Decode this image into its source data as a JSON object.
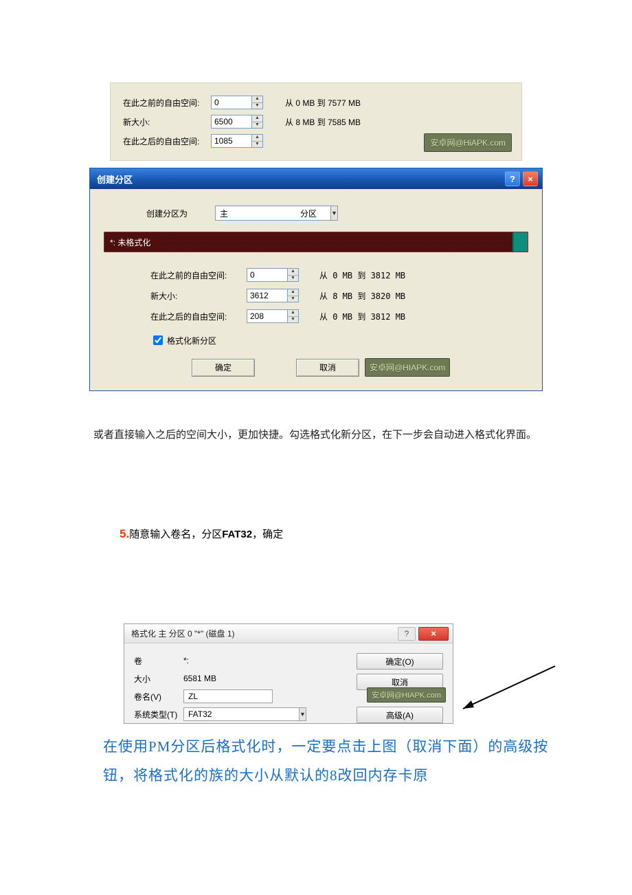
{
  "panel1": {
    "rows": [
      {
        "label": "在此之前的自由空间:",
        "value": "0",
        "range": "从 0 MB 到 7577 MB"
      },
      {
        "label": "新大小:",
        "value": "6500",
        "range": "从 8 MB 到 7585 MB"
      },
      {
        "label": "在此之后的自由空间:",
        "value": "1085",
        "range": ""
      }
    ],
    "watermark": "安卓网@HiAPK.com"
  },
  "dialog": {
    "title": "创建分区",
    "help": "?",
    "close": "×",
    "row1_label": "创建分区为",
    "row1_value": "主",
    "row1_after": "分区",
    "bar_label": "*: 未格式化",
    "rows": [
      {
        "label": "在此之前的自由空间:",
        "value": "0",
        "range": "从 0 MB 到 3812 MB"
      },
      {
        "label": "新大小:",
        "value": "3612",
        "range": "从 8 MB 到 3820 MB"
      },
      {
        "label": "在此之后的自由空间:",
        "value": "208",
        "range": "从 0 MB 到 3812 MB"
      }
    ],
    "format_chk": "格式化新分区",
    "ok": "确定",
    "cancel": "取消",
    "watermark": "安卓网@HIAPK.com"
  },
  "para1": "或者直接输入之后的空间大小，更加快捷。勾选格式化新分区，在下一步会自动进入格式化界面。",
  "step5": {
    "num": "5.",
    "t1": "随意输入卷名，分区",
    "bold": "FAT32",
    "t2": "，确定"
  },
  "fmt": {
    "title": "格式化 主 分区 0 \"*\" (磁盘 1)",
    "help": "?",
    "close": "×",
    "rows": {
      "volume_l": "卷",
      "volume_v": "*:",
      "size_l": "大小",
      "size_v": "6581 MB",
      "name_l": "卷名(V)",
      "name_v": "ZL",
      "type_l": "系统类型(T)",
      "type_v": "FAT32"
    },
    "btn_ok": "确定(O)",
    "btn_cancel": "取消",
    "btn_adv": "高级(A)",
    "watermark": "安卓网@HIAPK.com"
  },
  "blue_note": "在使用PM分区后格式化时，一定要点击上图（取消下面）的高级按钮，将格式化的族的大小从默认的8改回内存卡原"
}
